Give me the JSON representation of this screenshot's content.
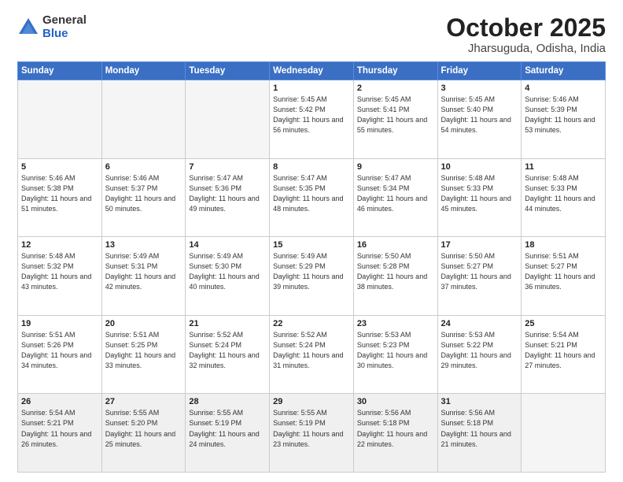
{
  "logo": {
    "general": "General",
    "blue": "Blue"
  },
  "title": "October 2025",
  "location": "Jharsuguda, Odisha, India",
  "weekdays": [
    "Sunday",
    "Monday",
    "Tuesday",
    "Wednesday",
    "Thursday",
    "Friday",
    "Saturday"
  ],
  "weeks": [
    [
      {
        "day": "",
        "sunrise": "",
        "sunset": "",
        "daylight": ""
      },
      {
        "day": "",
        "sunrise": "",
        "sunset": "",
        "daylight": ""
      },
      {
        "day": "",
        "sunrise": "",
        "sunset": "",
        "daylight": ""
      },
      {
        "day": "1",
        "sunrise": "Sunrise: 5:45 AM",
        "sunset": "Sunset: 5:42 PM",
        "daylight": "Daylight: 11 hours and 56 minutes."
      },
      {
        "day": "2",
        "sunrise": "Sunrise: 5:45 AM",
        "sunset": "Sunset: 5:41 PM",
        "daylight": "Daylight: 11 hours and 55 minutes."
      },
      {
        "day": "3",
        "sunrise": "Sunrise: 5:45 AM",
        "sunset": "Sunset: 5:40 PM",
        "daylight": "Daylight: 11 hours and 54 minutes."
      },
      {
        "day": "4",
        "sunrise": "Sunrise: 5:46 AM",
        "sunset": "Sunset: 5:39 PM",
        "daylight": "Daylight: 11 hours and 53 minutes."
      }
    ],
    [
      {
        "day": "5",
        "sunrise": "Sunrise: 5:46 AM",
        "sunset": "Sunset: 5:38 PM",
        "daylight": "Daylight: 11 hours and 51 minutes."
      },
      {
        "day": "6",
        "sunrise": "Sunrise: 5:46 AM",
        "sunset": "Sunset: 5:37 PM",
        "daylight": "Daylight: 11 hours and 50 minutes."
      },
      {
        "day": "7",
        "sunrise": "Sunrise: 5:47 AM",
        "sunset": "Sunset: 5:36 PM",
        "daylight": "Daylight: 11 hours and 49 minutes."
      },
      {
        "day": "8",
        "sunrise": "Sunrise: 5:47 AM",
        "sunset": "Sunset: 5:35 PM",
        "daylight": "Daylight: 11 hours and 48 minutes."
      },
      {
        "day": "9",
        "sunrise": "Sunrise: 5:47 AM",
        "sunset": "Sunset: 5:34 PM",
        "daylight": "Daylight: 11 hours and 46 minutes."
      },
      {
        "day": "10",
        "sunrise": "Sunrise: 5:48 AM",
        "sunset": "Sunset: 5:33 PM",
        "daylight": "Daylight: 11 hours and 45 minutes."
      },
      {
        "day": "11",
        "sunrise": "Sunrise: 5:48 AM",
        "sunset": "Sunset: 5:33 PM",
        "daylight": "Daylight: 11 hours and 44 minutes."
      }
    ],
    [
      {
        "day": "12",
        "sunrise": "Sunrise: 5:48 AM",
        "sunset": "Sunset: 5:32 PM",
        "daylight": "Daylight: 11 hours and 43 minutes."
      },
      {
        "day": "13",
        "sunrise": "Sunrise: 5:49 AM",
        "sunset": "Sunset: 5:31 PM",
        "daylight": "Daylight: 11 hours and 42 minutes."
      },
      {
        "day": "14",
        "sunrise": "Sunrise: 5:49 AM",
        "sunset": "Sunset: 5:30 PM",
        "daylight": "Daylight: 11 hours and 40 minutes."
      },
      {
        "day": "15",
        "sunrise": "Sunrise: 5:49 AM",
        "sunset": "Sunset: 5:29 PM",
        "daylight": "Daylight: 11 hours and 39 minutes."
      },
      {
        "day": "16",
        "sunrise": "Sunrise: 5:50 AM",
        "sunset": "Sunset: 5:28 PM",
        "daylight": "Daylight: 11 hours and 38 minutes."
      },
      {
        "day": "17",
        "sunrise": "Sunrise: 5:50 AM",
        "sunset": "Sunset: 5:27 PM",
        "daylight": "Daylight: 11 hours and 37 minutes."
      },
      {
        "day": "18",
        "sunrise": "Sunrise: 5:51 AM",
        "sunset": "Sunset: 5:27 PM",
        "daylight": "Daylight: 11 hours and 36 minutes."
      }
    ],
    [
      {
        "day": "19",
        "sunrise": "Sunrise: 5:51 AM",
        "sunset": "Sunset: 5:26 PM",
        "daylight": "Daylight: 11 hours and 34 minutes."
      },
      {
        "day": "20",
        "sunrise": "Sunrise: 5:51 AM",
        "sunset": "Sunset: 5:25 PM",
        "daylight": "Daylight: 11 hours and 33 minutes."
      },
      {
        "day": "21",
        "sunrise": "Sunrise: 5:52 AM",
        "sunset": "Sunset: 5:24 PM",
        "daylight": "Daylight: 11 hours and 32 minutes."
      },
      {
        "day": "22",
        "sunrise": "Sunrise: 5:52 AM",
        "sunset": "Sunset: 5:24 PM",
        "daylight": "Daylight: 11 hours and 31 minutes."
      },
      {
        "day": "23",
        "sunrise": "Sunrise: 5:53 AM",
        "sunset": "Sunset: 5:23 PM",
        "daylight": "Daylight: 11 hours and 30 minutes."
      },
      {
        "day": "24",
        "sunrise": "Sunrise: 5:53 AM",
        "sunset": "Sunset: 5:22 PM",
        "daylight": "Daylight: 11 hours and 29 minutes."
      },
      {
        "day": "25",
        "sunrise": "Sunrise: 5:54 AM",
        "sunset": "Sunset: 5:21 PM",
        "daylight": "Daylight: 11 hours and 27 minutes."
      }
    ],
    [
      {
        "day": "26",
        "sunrise": "Sunrise: 5:54 AM",
        "sunset": "Sunset: 5:21 PM",
        "daylight": "Daylight: 11 hours and 26 minutes."
      },
      {
        "day": "27",
        "sunrise": "Sunrise: 5:55 AM",
        "sunset": "Sunset: 5:20 PM",
        "daylight": "Daylight: 11 hours and 25 minutes."
      },
      {
        "day": "28",
        "sunrise": "Sunrise: 5:55 AM",
        "sunset": "Sunset: 5:19 PM",
        "daylight": "Daylight: 11 hours and 24 minutes."
      },
      {
        "day": "29",
        "sunrise": "Sunrise: 5:55 AM",
        "sunset": "Sunset: 5:19 PM",
        "daylight": "Daylight: 11 hours and 23 minutes."
      },
      {
        "day": "30",
        "sunrise": "Sunrise: 5:56 AM",
        "sunset": "Sunset: 5:18 PM",
        "daylight": "Daylight: 11 hours and 22 minutes."
      },
      {
        "day": "31",
        "sunrise": "Sunrise: 5:56 AM",
        "sunset": "Sunset: 5:18 PM",
        "daylight": "Daylight: 11 hours and 21 minutes."
      },
      {
        "day": "",
        "sunrise": "",
        "sunset": "",
        "daylight": ""
      }
    ]
  ]
}
